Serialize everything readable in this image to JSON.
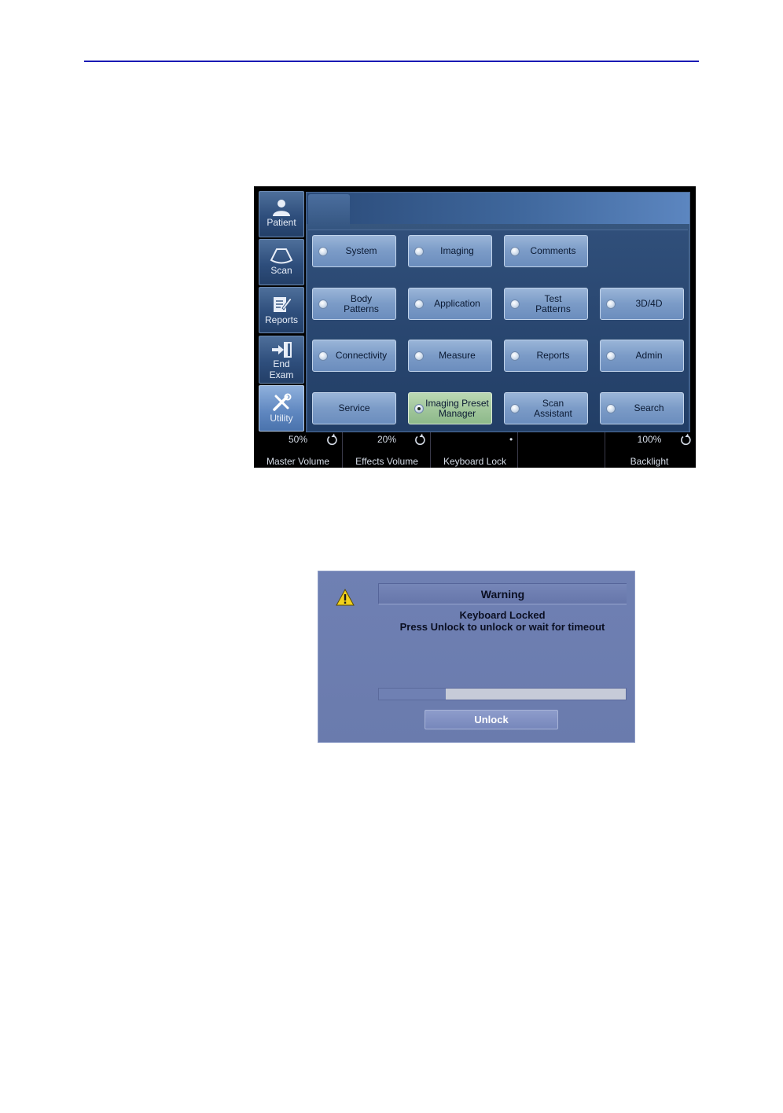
{
  "side_tabs": [
    {
      "label": "Patient",
      "icon": "patient-icon"
    },
    {
      "label": "Scan",
      "icon": "scan-icon"
    },
    {
      "label": "Reports",
      "icon": "reports-icon"
    },
    {
      "label": "End\nExam",
      "icon": "end-exam-icon"
    },
    {
      "label": "Utility",
      "icon": "utility-icon"
    }
  ],
  "active_side_tab": "Utility",
  "buttons": [
    {
      "label": "System"
    },
    {
      "label": "Imaging"
    },
    {
      "label": "Comments"
    },
    {
      "label": "Body\nPatterns"
    },
    {
      "label": "Application"
    },
    {
      "label": "Test\nPatterns"
    },
    {
      "label": "3D/4D"
    },
    {
      "label": "Connectivity"
    },
    {
      "label": "Measure"
    },
    {
      "label": "Reports"
    },
    {
      "label": "Admin"
    },
    {
      "label": "Service"
    },
    {
      "label": "Imaging Preset\nManager",
      "selected": true
    },
    {
      "label": "Scan\nAssistant"
    },
    {
      "label": "Search"
    }
  ],
  "status_bar": {
    "master_volume": {
      "value": "50%",
      "label": "Master Volume"
    },
    "effects_volume": {
      "value": "20%",
      "label": "Effects Volume"
    },
    "keyboard_lock": {
      "value": "•",
      "label": "Keyboard Lock"
    },
    "backlight": {
      "value": "100%",
      "label": "Backlight"
    }
  },
  "dialog": {
    "title": "Warning",
    "message_line1": "Keyboard Locked",
    "message_line2": "Press Unlock to unlock or wait for timeout",
    "progress": 0.27,
    "unlock_label": "Unlock"
  },
  "colors": {
    "panel_blue": "#2e4e7c",
    "button_blue": "#7b9bc7",
    "button_selected_green": "#9fc59a",
    "dialog_bg": "#6f80b3",
    "warning_yellow": "#f2d21c",
    "rule_blue": "#1a1ab4"
  }
}
